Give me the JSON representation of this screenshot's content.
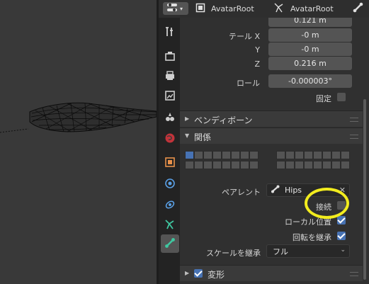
{
  "header": {
    "object_name": "AvatarRoot",
    "armature_name": "AvatarRoot"
  },
  "transform": {
    "head_z_value": "0.121 m",
    "tail_x_label": "テール X",
    "tail_x_value": "-0 m",
    "tail_y_label": "Y",
    "tail_y_value": "-0 m",
    "tail_z_label": "Z",
    "tail_z_value": "0.216 m",
    "roll_label": "ロール",
    "roll_value": "-0.000003°",
    "lock_label": "固定",
    "lock_checked": false
  },
  "panels": {
    "bendy_bones": "ベンディボーン",
    "relations": "関係",
    "deform": "変形"
  },
  "relations": {
    "layers_selected_index": 0,
    "parent_label": "ペアレント",
    "parent_value": "Hips",
    "connected_label": "接続",
    "connected_checked": false,
    "local_location_label": "ローカル位置",
    "local_location_checked": true,
    "inherit_rotation_label": "回転を継承",
    "inherit_rotation_checked": true,
    "inherit_scale_label": "スケールを継承",
    "inherit_scale_value": "フル"
  },
  "deform": {
    "checked": true
  },
  "colors": {
    "accent": "#4772b3",
    "highlight_circle": "#f2ec1e",
    "bone_tab": "#3fc7a0"
  }
}
